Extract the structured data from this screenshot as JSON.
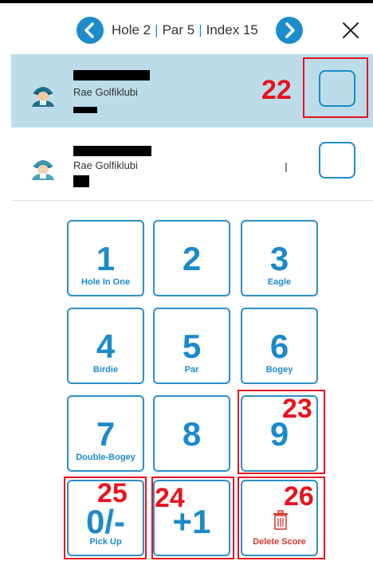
{
  "header": {
    "hole": "Hole 2",
    "par": "Par 5",
    "index": "Index 15",
    "separator": "|"
  },
  "players": [
    {
      "club": "Rae Golfiklubi",
      "score": "",
      "active": true
    },
    {
      "club": "Rae Golfiklubi",
      "score": "",
      "active": false
    }
  ],
  "keypad": {
    "keys": [
      {
        "num": "1",
        "label": "Hole In One"
      },
      {
        "num": "2",
        "label": ""
      },
      {
        "num": "3",
        "label": "Eagle"
      },
      {
        "num": "4",
        "label": "Birdie"
      },
      {
        "num": "5",
        "label": "Par"
      },
      {
        "num": "6",
        "label": "Bogey"
      },
      {
        "num": "7",
        "label": "Double-Bogey"
      },
      {
        "num": "8",
        "label": ""
      },
      {
        "num": "9",
        "label": ""
      },
      {
        "num": "0/-",
        "label": "Pick Up"
      },
      {
        "num": "+1",
        "label": ""
      },
      {
        "num": "",
        "label": "Delete Score"
      }
    ]
  },
  "annotations": {
    "a22": "22",
    "a23": "23",
    "a24": "24",
    "a25": "25",
    "a26": "26"
  },
  "colors": {
    "accent": "#1d8ccc",
    "active_row": "#bcdcea",
    "annotation": "#e8121e",
    "delete": "#d9352b"
  }
}
